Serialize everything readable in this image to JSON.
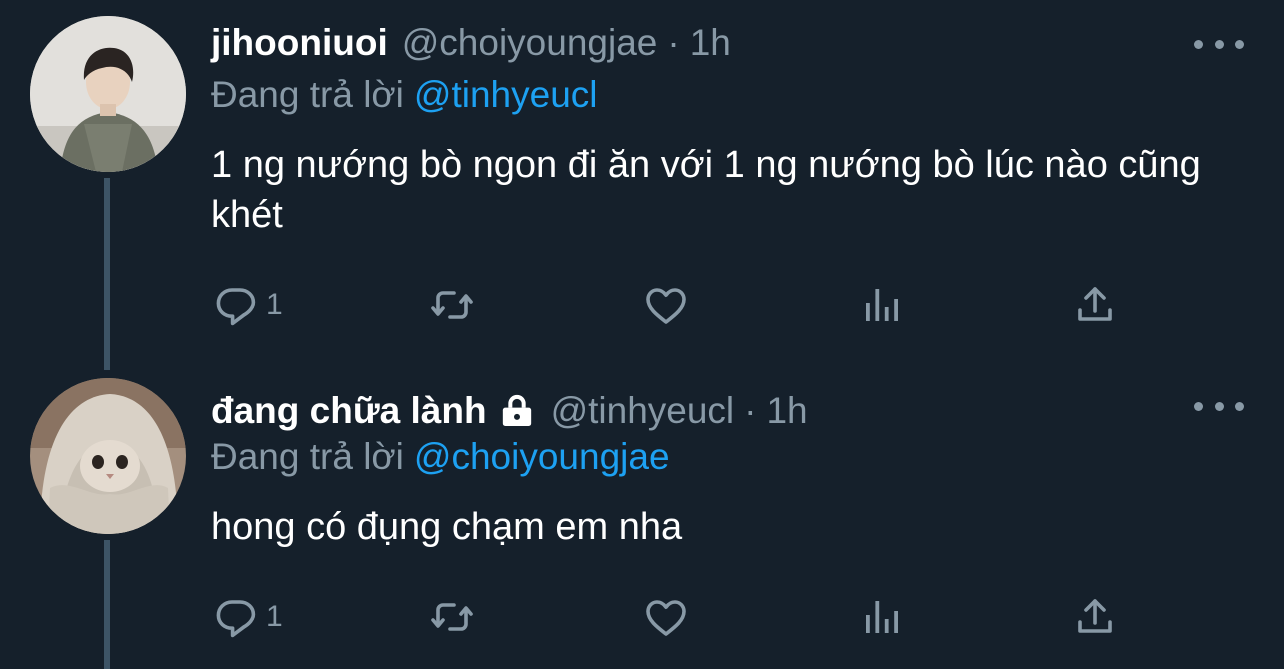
{
  "tweets": [
    {
      "display_name": "jihooniuoi",
      "handle": "@choiyoungjae",
      "time": "1h",
      "reply_prefix": "Đang trả lời",
      "reply_mention": "@tinhyeucl",
      "text": "1 ng nướng bò ngon đi ăn với 1 ng nướng bò lúc nào cũng khét",
      "reply_count": "1",
      "avatar": "photo of person in green jacket",
      "locked": false
    },
    {
      "display_name": "đang chữa lành",
      "handle": "@tinhyeucl",
      "time": "1h",
      "reply_prefix": "Đang trả lời",
      "reply_mention": "@choiyoungjae",
      "text": "hong có đụng chạm em nha",
      "reply_count": "1",
      "avatar": "photo of cat wrapped in blanket",
      "locked": true
    }
  ],
  "separator": "·",
  "colors": {
    "background": "#15202b",
    "secondary_text": "#8899a6",
    "accent": "#1da1f2",
    "thread_line": "#3d5466"
  },
  "icons": [
    "reply-icon",
    "retweet-icon",
    "like-icon",
    "analytics-icon",
    "share-icon",
    "more-icon",
    "lock-icon"
  ]
}
